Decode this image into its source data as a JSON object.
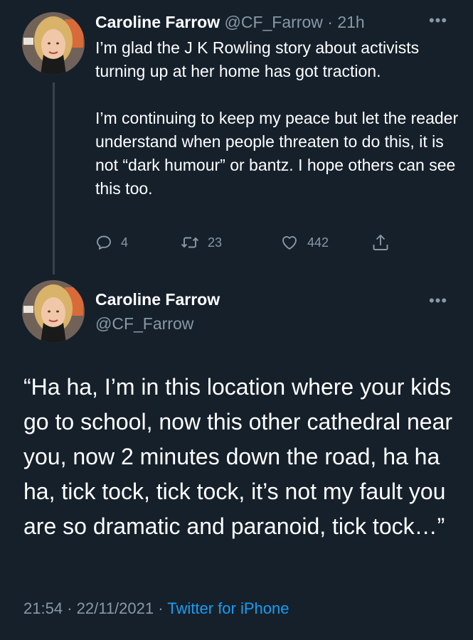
{
  "tweet1": {
    "author_name": "Caroline Farrow",
    "author_handle": "@CF_Farrow",
    "separator": "·",
    "time_ago": "21h",
    "more_icon": "more-horizontal-icon",
    "paragraphs": [
      "I’m glad the J K Rowling story about activists turning up at her home has got traction.",
      "I’m continuing to keep my peace but let the reader understand when people threaten to do this, it is not “dark humour” or bantz. I hope others can see this too."
    ],
    "actions": {
      "reply_count": "4",
      "retweet_count": "23",
      "like_count": "442",
      "icons": [
        "reply-icon",
        "retweet-icon",
        "like-icon",
        "share-icon"
      ]
    }
  },
  "tweet2": {
    "author_name": "Caroline Farrow",
    "author_handle": "@CF_Farrow",
    "more_icon": "more-horizontal-icon",
    "text": "“Ha ha, I’m in this location where your kids go to school, now this other cathedral near you, now 2 minutes down the road, ha ha ha, tick tock, tick tock, it’s not my fault you are so dramatic and paranoid, tick tock…”",
    "meta": {
      "time": "21:54",
      "separator": "·",
      "date": "22/11/2021",
      "source": "Twitter for iPhone"
    }
  },
  "colors": {
    "background": "#15202b",
    "text_primary": "#ffffff",
    "text_secondary": "#8899a6",
    "link": "#1d9bf0",
    "thread_line": "#38444d"
  }
}
